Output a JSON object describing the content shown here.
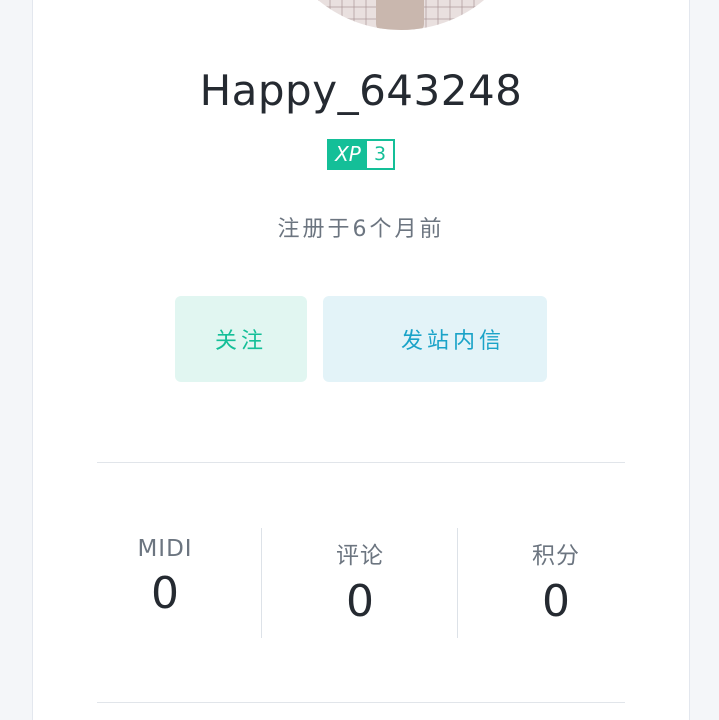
{
  "profile": {
    "username": "Happy_643248",
    "xp_label": "XP",
    "xp_level": "3",
    "registered": "注册于6个月前"
  },
  "actions": {
    "follow_label": "关注",
    "message_label": "发站内信"
  },
  "stats": [
    {
      "label": "MIDI",
      "value": "0"
    },
    {
      "label": "评论",
      "value": "0"
    },
    {
      "label": "积分",
      "value": "0"
    }
  ],
  "colors": {
    "accent_green": "#14bf98",
    "accent_blue": "#1aa3c8"
  }
}
